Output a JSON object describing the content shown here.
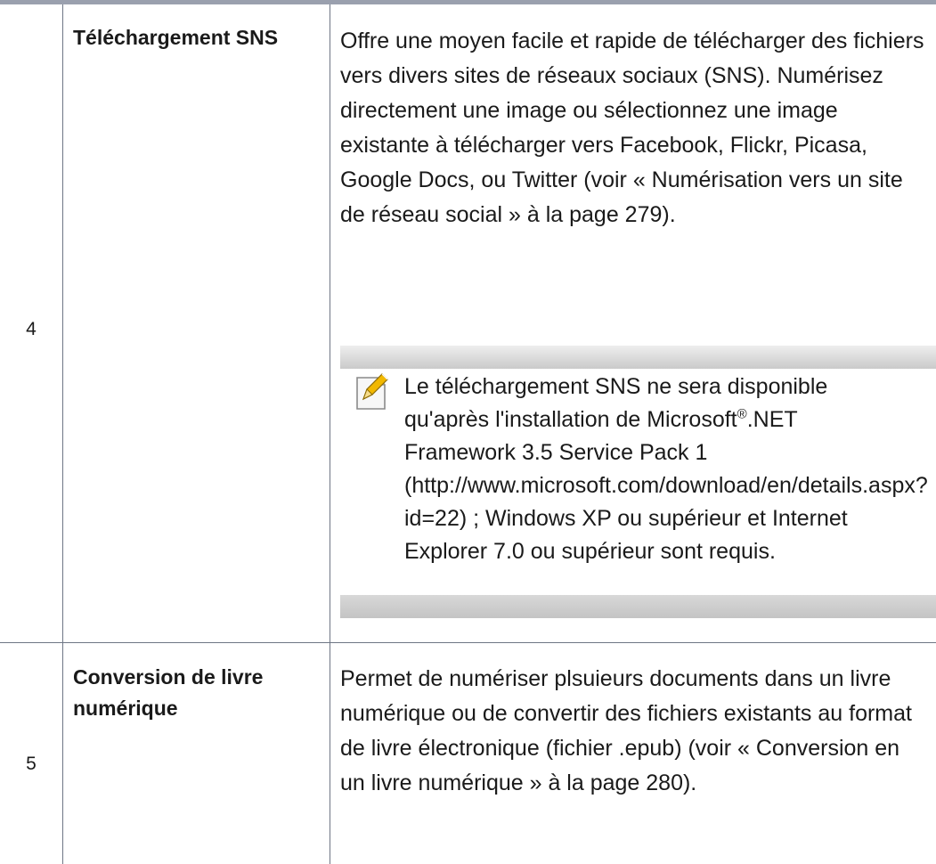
{
  "rows": [
    {
      "number": "4",
      "feature": "Téléchargement SNS",
      "description": "Offre une moyen facile et rapide de télécharger des fichiers vers divers sites de réseaux sociaux (SNS). Numérisez directement une image ou sélectionnez une image existante à télécharger vers Facebook, Flickr, Picasa, Google Docs, ou Twitter (voir « Numérisation vers un site de réseau social » à la page 279).",
      "note": {
        "icon": "note-pencil-icon",
        "text_before": "Le téléchargement SNS ne sera disponible qu'après l'installation de Microsoft",
        "superscript": "®",
        "text_after": ".NET Framework 3.5 Service Pack 1 (http://www.microsoft.com/download/en/details.aspx?id=22) ; Windows XP ou supérieur et Internet Explorer 7.0 ou supérieur sont requis."
      }
    },
    {
      "number": "5",
      "feature": "Conversion de livre numérique",
      "description": "Permet de numériser plsuieurs documents dans un livre numérique ou de convertir des fichiers existants au format de livre électronique (fichier .epub) (voir « Conversion en un livre numérique » à la page 280)."
    }
  ],
  "colors": {
    "top_rule": "#9aa0ae",
    "grid_line": "#6e7685",
    "note_band": "#d0d0d0",
    "note_icon_accent": "#f2b800"
  }
}
